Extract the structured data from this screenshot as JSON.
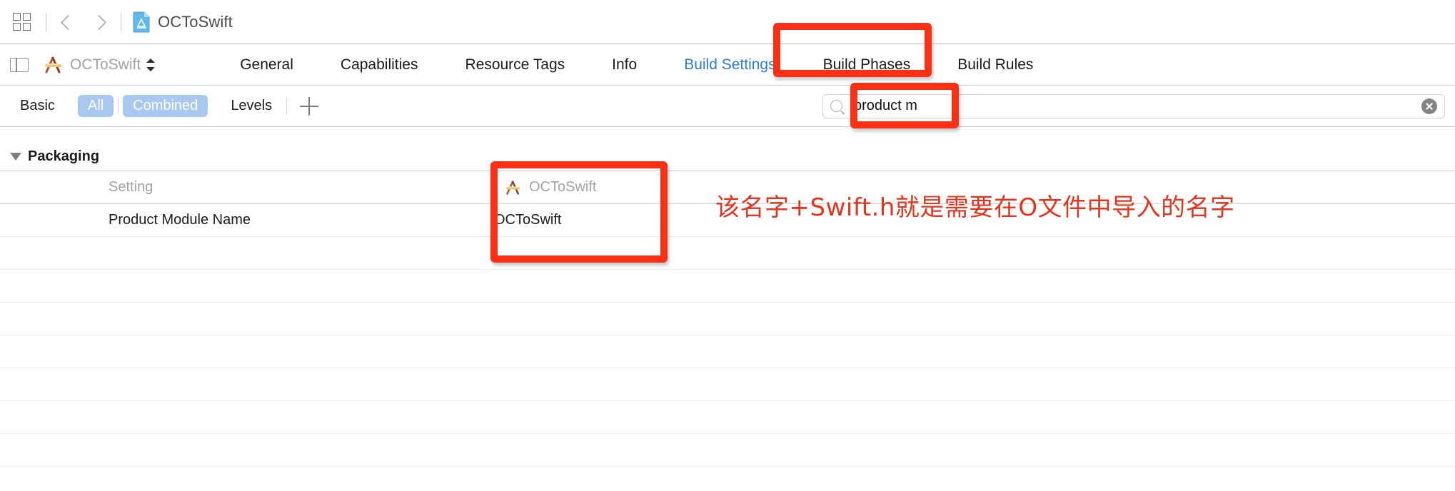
{
  "window": {
    "breadcrumb": "OCToSwift",
    "doc_icon": "swift-project-document-icon",
    "grid_icon": "grid-layout-icon",
    "back_icon": "back-chevron-icon",
    "forward_icon": "forward-chevron-icon"
  },
  "tabbar": {
    "panel_toggle_icon": "left-panel-toggle-icon",
    "target_icon": "xcode-target-icon",
    "target_name": "OCToSwift",
    "stepper_icon": "up-down-stepper-icon",
    "tabs": [
      {
        "label": "General",
        "active": false
      },
      {
        "label": "Capabilities",
        "active": false
      },
      {
        "label": "Resource Tags",
        "active": false
      },
      {
        "label": "Info",
        "active": false
      },
      {
        "label": "Build Settings",
        "active": true
      },
      {
        "label": "Build Phases",
        "active": false
      },
      {
        "label": "Build Rules",
        "active": false
      }
    ]
  },
  "filterbar": {
    "segments": [
      {
        "label": "Basic",
        "selected": false
      },
      {
        "label": "All",
        "selected": true
      },
      {
        "label": "Combined",
        "selected": true
      },
      {
        "label": "Levels",
        "selected": false
      }
    ],
    "add_button": "add-setting-button",
    "search": {
      "value": "product m",
      "placeholder": "",
      "search_icon": "search-icon",
      "clear_icon": "clear-search-icon"
    }
  },
  "settings": {
    "group": {
      "title": "Packaging",
      "expanded": true,
      "disclosure_icon": "disclosure-triangle-down-icon"
    },
    "columns": {
      "setting": "Setting",
      "target": "OCToSwift",
      "target_icon": "xcode-target-icon"
    },
    "rows": [
      {
        "setting": "Product Module Name",
        "value": "OCToSwift"
      }
    ],
    "empty_row_count": 8
  },
  "annotations": {
    "note": "该名字+Swift.h就是需要在O文件中导入的名字",
    "note_color": "#e2351f",
    "box_color": "#fa2f13",
    "boxes": [
      {
        "name": "build-settings-tab-highlight"
      },
      {
        "name": "search-query-highlight"
      },
      {
        "name": "product-module-name-value-highlight"
      }
    ]
  }
}
